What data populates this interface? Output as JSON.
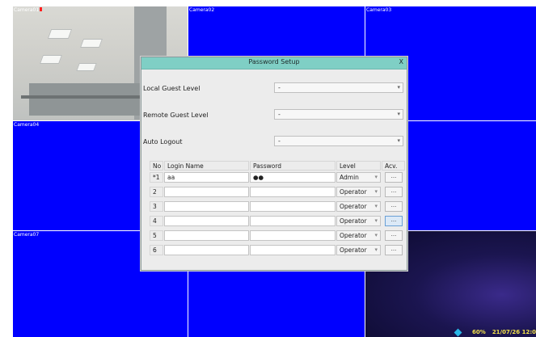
{
  "cameras": [
    {
      "label": "Camera01",
      "recording": true
    },
    {
      "label": "Camera02"
    },
    {
      "label": "Camera03"
    },
    {
      "label": "Camera04"
    },
    {
      "label": "Camera07"
    }
  ],
  "status": {
    "percent": "60%",
    "datetime": "21/07/26 12:0"
  },
  "dialog": {
    "title": "Password Setup",
    "close": "X",
    "fields": [
      {
        "label": "Local Guest Level",
        "value": "-"
      },
      {
        "label": "Remote Guest Level",
        "value": "-"
      },
      {
        "label": "Auto Logout",
        "value": "-"
      }
    ],
    "dropdown_arrow": "▾",
    "table": {
      "headers": {
        "no": "No",
        "login": "Login Name",
        "password": "Password",
        "level": "Level",
        "acv": "Acv."
      },
      "rows": [
        {
          "no": "*1",
          "login": "aa",
          "password": "●●",
          "level": "Admin",
          "acv": "..."
        },
        {
          "no": "2",
          "login": "",
          "password": "",
          "level": "Operator",
          "acv": "..."
        },
        {
          "no": "3",
          "login": "",
          "password": "",
          "level": "Operator",
          "acv": "..."
        },
        {
          "no": "4",
          "login": "",
          "password": "",
          "level": "Operator",
          "acv": "..."
        },
        {
          "no": "5",
          "login": "",
          "password": "",
          "level": "Operator",
          "acv": "..."
        },
        {
          "no": "6",
          "login": "",
          "password": "",
          "level": "Operator",
          "acv": "..."
        }
      ]
    }
  }
}
